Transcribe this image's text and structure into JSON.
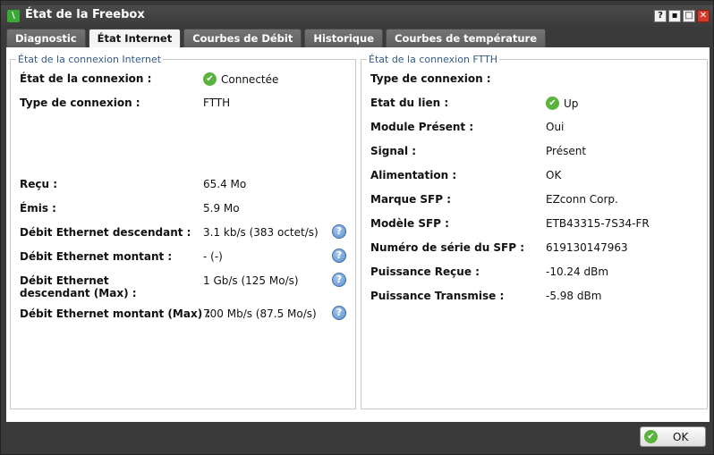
{
  "window": {
    "title": "État de la Freebox",
    "icon": "freebox-app-icon",
    "controls": [
      "?",
      "▪",
      "□",
      "✕"
    ]
  },
  "tabs": [
    {
      "label": "Diagnostic",
      "active": false
    },
    {
      "label": "État Internet",
      "active": true
    },
    {
      "label": "Courbes de Débit",
      "active": false
    },
    {
      "label": "Historique",
      "active": false
    },
    {
      "label": "Courbes de température",
      "active": false
    }
  ],
  "internet": {
    "legend": "État de la connexion Internet",
    "rows": [
      {
        "label": "État de la connexion :",
        "value": "Connectée",
        "status_icon": "check-icon"
      },
      {
        "label": "Type de connexion :",
        "value": "FTTH"
      },
      {
        "label": "Reçu :",
        "value": "65.4 Mo"
      },
      {
        "label": "Émis :",
        "value": "5.9 Mo"
      },
      {
        "label": "Débit Ethernet descendant :",
        "value": "3.1 kb/s (383 octet/s)",
        "help": "?"
      },
      {
        "label": "Débit Ethernet montant :",
        "value": "- (-)",
        "help": "?"
      },
      {
        "label": "Débit Ethernet descendant (Max) :",
        "value": "1 Gb/s (125 Mo/s)",
        "help": "?"
      },
      {
        "label": "Débit Ethernet montant (Max) :",
        "value": "700 Mb/s (87.5 Mo/s)",
        "help": "?"
      }
    ]
  },
  "ftth": {
    "legend": "État de la connexion FTTH",
    "rows": [
      {
        "label": "Type de connexion :",
        "value": ""
      },
      {
        "label": "Etat du lien :",
        "value": "Up",
        "status_icon": "check-icon"
      },
      {
        "label": "Module Présent :",
        "value": "Oui"
      },
      {
        "label": "Signal :",
        "value": "Présent"
      },
      {
        "label": "Alimentation :",
        "value": "OK"
      },
      {
        "label": "Marque SFP :",
        "value": "EZconn Corp."
      },
      {
        "label": "Modèle SFP :",
        "value": "ETB43315-7S34-FR"
      },
      {
        "label": "Numéro de série du SFP :",
        "value": "619130147963"
      },
      {
        "label": "Puissance Reçue :",
        "value": "-10.24 dBm"
      },
      {
        "label": "Puissance Transmise :",
        "value": "-5.98 dBm"
      }
    ]
  },
  "footer": {
    "ok_label": "OK"
  },
  "colors": {
    "chrome": "#3a3a3a",
    "legend_text": "#335a88",
    "status_ok": "#59b33c",
    "help_icon": "#5a8fcc",
    "close_button": "#d23a2c"
  }
}
